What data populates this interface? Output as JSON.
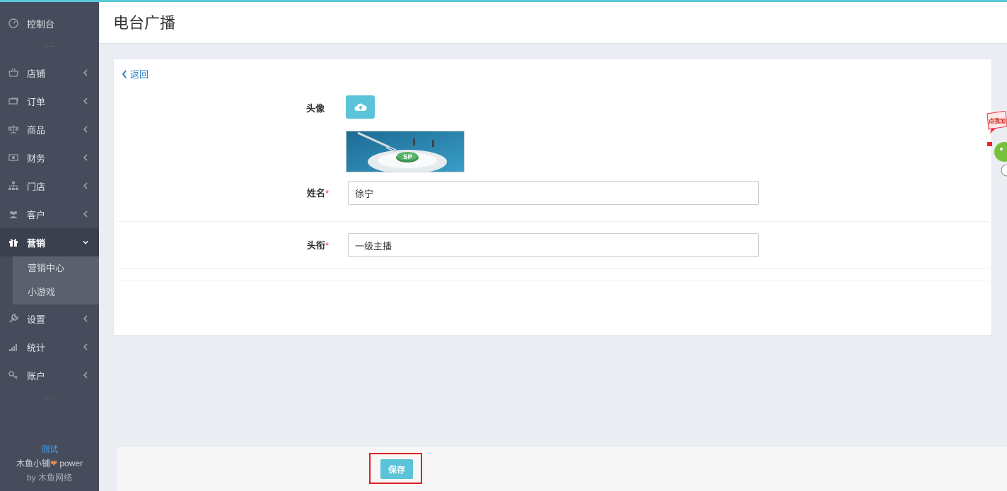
{
  "sidebar": {
    "items": [
      {
        "label": "控制台",
        "icon": "dashboard-icon"
      },
      {
        "label": "店铺",
        "icon": "store-icon"
      },
      {
        "label": "订单",
        "icon": "order-icon"
      },
      {
        "label": "商品",
        "icon": "scale-icon"
      },
      {
        "label": "财务",
        "icon": "money-icon"
      },
      {
        "label": "门店",
        "icon": "sitemap-icon"
      },
      {
        "label": "客户",
        "icon": "users-icon"
      },
      {
        "label": "营销",
        "icon": "gift-icon",
        "active": true
      },
      {
        "label": "设置",
        "icon": "wrench-icon"
      },
      {
        "label": "统计",
        "icon": "signal-icon"
      },
      {
        "label": "账户",
        "icon": "key-icon"
      }
    ],
    "submenu": [
      {
        "label": "营销中心"
      },
      {
        "label": "小游戏"
      }
    ],
    "dots": "....",
    "footer": {
      "test": "测试",
      "brand_prefix": "木鱼小铺",
      "brand_suffix": " power",
      "by": "by 木鱼网络"
    }
  },
  "header": {
    "title": "电台广播"
  },
  "form": {
    "back_label": "返回",
    "avatar_label": "头像",
    "name_label": "姓名",
    "name_value": "徐宁",
    "title_label": "头衔",
    "title_value": "一级主播",
    "required_mark": "*"
  },
  "float_widget": {
    "text": "点我加"
  },
  "footer_bar": {
    "save_label": "保存"
  },
  "colors": {
    "accent": "#5bc4d8",
    "sidebar_bg": "#464c5b",
    "link": "#2e7ec6",
    "highlight_frame": "#e02020"
  }
}
